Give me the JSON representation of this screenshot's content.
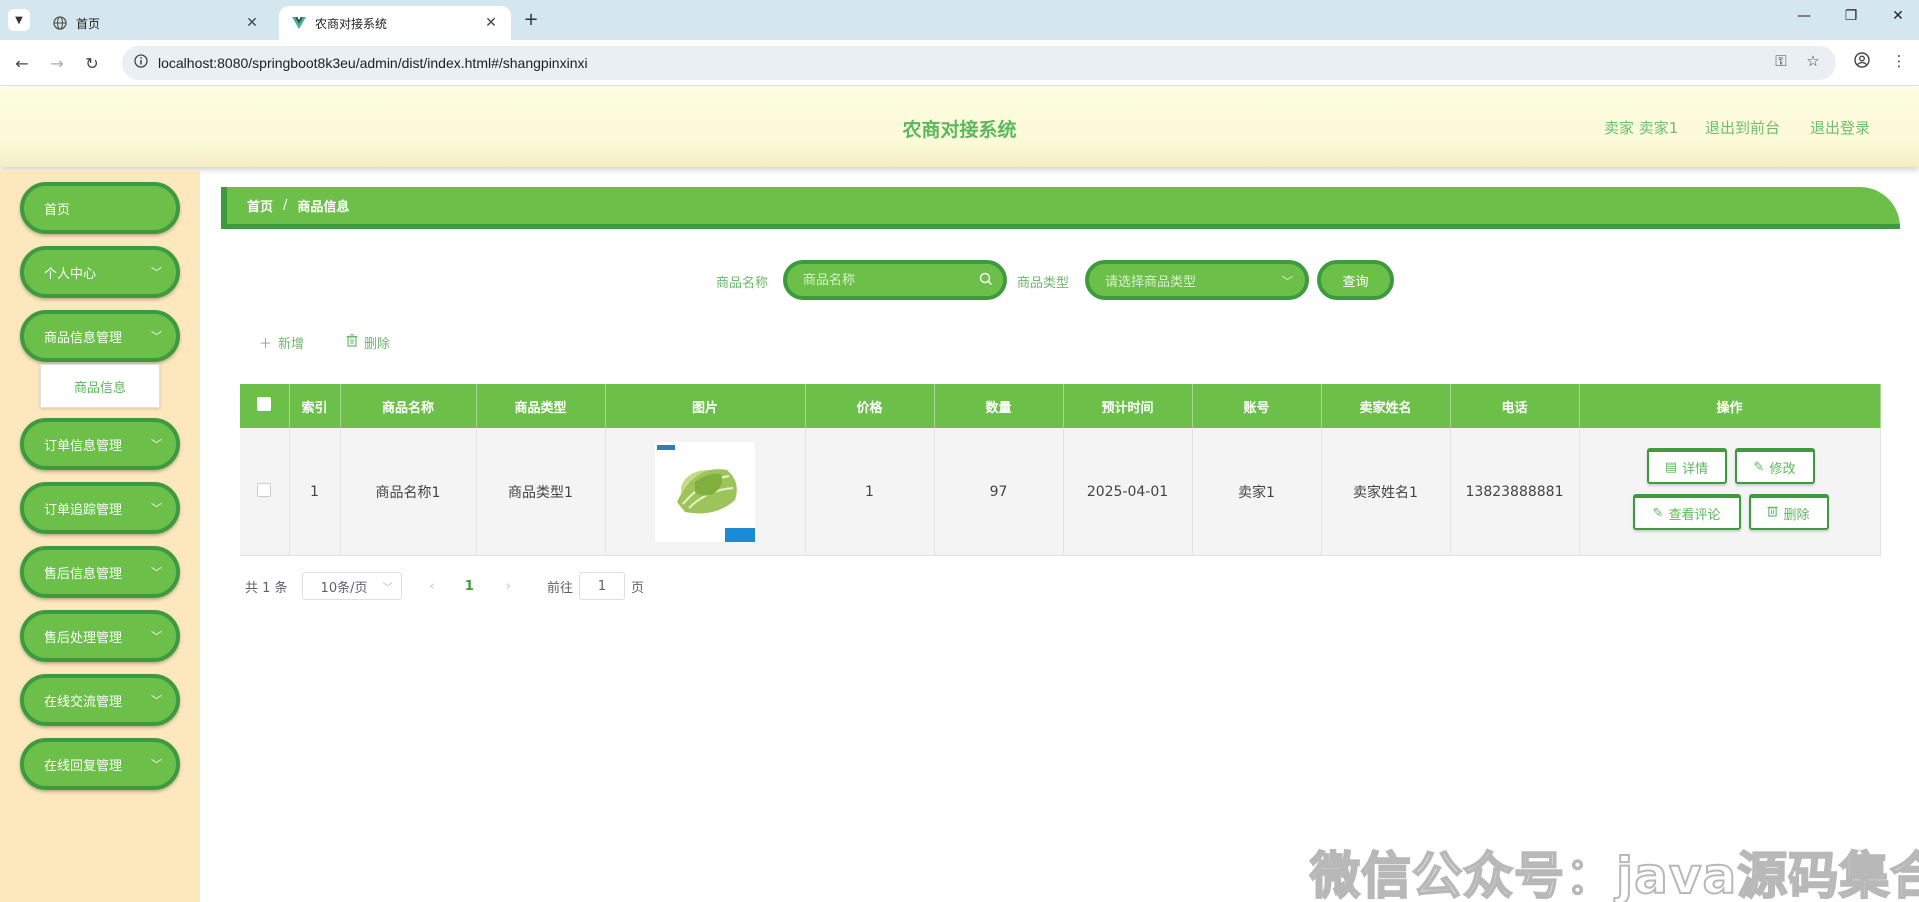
{
  "browser": {
    "tabs": [
      {
        "title": "首页"
      },
      {
        "title": "农商对接系统"
      }
    ],
    "url": "localhost:8080/springboot8k3eu/admin/dist/index.html#/shangpinxinxi"
  },
  "header": {
    "title": "农商对接系统",
    "user": "卖家 卖家1",
    "to_front": "退出到前台",
    "logout": "退出登录"
  },
  "sidebar": {
    "items": [
      {
        "label": "首页"
      },
      {
        "label": "个人中心"
      },
      {
        "label": "商品信息管理"
      },
      {
        "label": "订单信息管理"
      },
      {
        "label": "订单追踪管理"
      },
      {
        "label": "售后信息管理"
      },
      {
        "label": "售后处理管理"
      },
      {
        "label": "在线交流管理"
      },
      {
        "label": "在线回复管理"
      }
    ],
    "submenu": {
      "label": "商品信息"
    }
  },
  "breadcrumb": {
    "home": "首页",
    "separator": "/",
    "current": "商品信息"
  },
  "search": {
    "name_label": "商品名称",
    "name_placeholder": "商品名称",
    "type_label": "商品类型",
    "type_placeholder": "请选择商品类型",
    "query_button": "查询"
  },
  "actions": {
    "add": "新增",
    "delete": "删除"
  },
  "table": {
    "columns": [
      "索引",
      "商品名称",
      "商品类型",
      "图片",
      "价格",
      "数量",
      "预计时间",
      "账号",
      "卖家姓名",
      "电话",
      "操作"
    ],
    "rows": [
      {
        "index": "1",
        "name": "商品名称1",
        "type": "商品类型1",
        "price": "1",
        "quantity": "97",
        "date": "2025-04-01",
        "account": "卖家1",
        "seller": "卖家姓名1",
        "phone": "13823888881",
        "ops": {
          "detail": "详情",
          "edit": "修改",
          "reviews": "查看评论",
          "delete": "删除"
        }
      }
    ]
  },
  "pagination": {
    "total": "共 1 条",
    "page_size": "10条/页",
    "current_page": "1",
    "goto_label": "前往",
    "goto_value": "1",
    "goto_suffix": "页"
  },
  "watermark": "微信公众号：java源码集合",
  "colors": {
    "primary_green": "#6cc04a",
    "dark_green": "#3e9a3e",
    "sidebar_bg": "#fde8bd"
  }
}
